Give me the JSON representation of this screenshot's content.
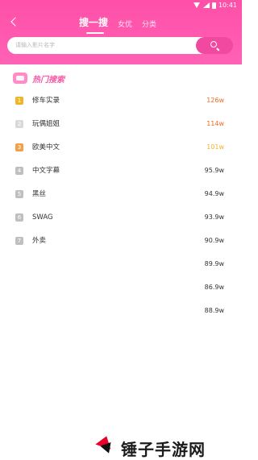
{
  "status": {
    "time": "10:41"
  },
  "nav": {
    "tabs": [
      {
        "label": "搜一搜",
        "active": true
      },
      {
        "label": "女优",
        "active": false
      },
      {
        "label": "分类",
        "active": false
      }
    ]
  },
  "search": {
    "placeholder": "请输入影片名字"
  },
  "hot": {
    "title": "热门搜索",
    "items": [
      {
        "rank": "1",
        "name": "修车实录",
        "count": "126w"
      },
      {
        "rank": "2",
        "name": "玩偶姐姐",
        "count": "114w"
      },
      {
        "rank": "3",
        "name": "欧美中文",
        "count": "101w"
      },
      {
        "rank": "4",
        "name": "中文字幕",
        "count": "95.9w"
      },
      {
        "rank": "5",
        "name": "黑丝",
        "count": "94.9w"
      },
      {
        "rank": "6",
        "name": "SWAG",
        "count": "93.9w"
      },
      {
        "rank": "7",
        "name": "外卖",
        "count": "90.9w"
      },
      {
        "rank": "",
        "name": "",
        "count": "89.9w"
      },
      {
        "rank": "",
        "name": "",
        "count": "86.9w"
      },
      {
        "rank": "",
        "name": "",
        "count": "88.9w"
      }
    ]
  },
  "colors": {
    "header_pink": "#ff58ad",
    "button_pink": "#f148a0",
    "rank1": "#f0b428",
    "rank2": "#d9d9d9",
    "rank3": "#f3a04c",
    "rank_other": "#bfbfbf",
    "count_hot": "#ef6a21",
    "count_gold": "#f0b428"
  },
  "watermark": {
    "text": "锤子手游网"
  }
}
